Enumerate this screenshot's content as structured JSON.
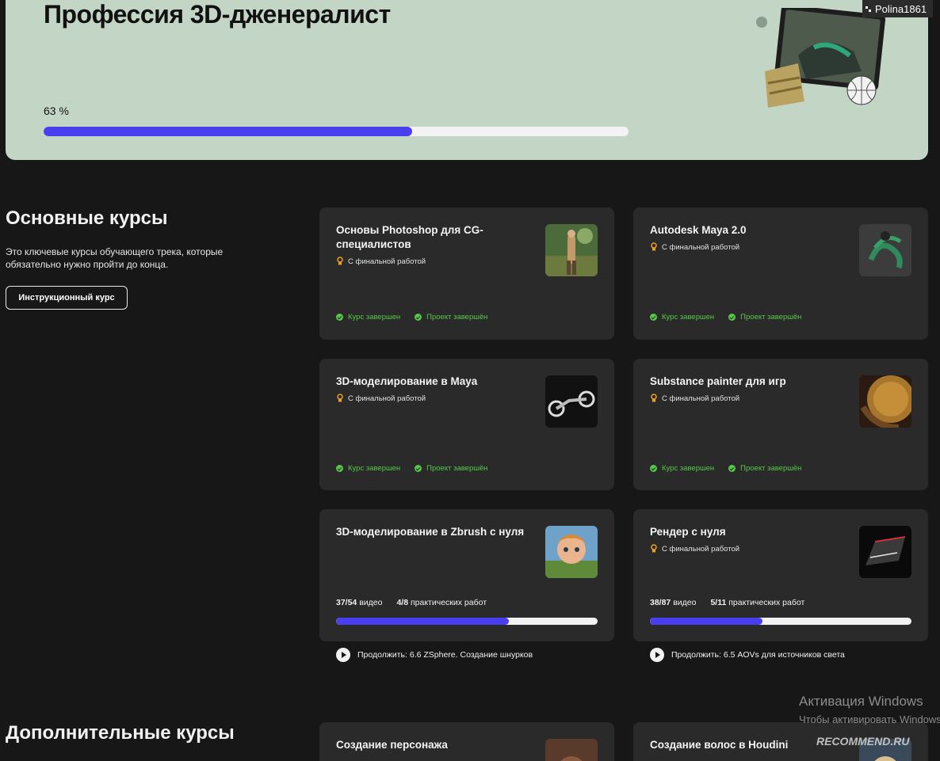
{
  "hero": {
    "title": "Профессия 3D-дженералист",
    "progress_label": "63 %",
    "progress": 0.63
  },
  "user": {
    "name": "Polina1861"
  },
  "main_section": {
    "title": "Основные курсы",
    "description": "Это ключевые курсы обучающего трека, которые обязательно нужно пройти до конца.",
    "button_label": "Инструкционный курс"
  },
  "extra_section": {
    "title": "Дополнительные курсы"
  },
  "cards": [
    {
      "title": "Основы Photoshop для CG-специалистов",
      "tag": "С финальной работой",
      "status_course": "Курс завершен",
      "status_project": "Проект завершён"
    },
    {
      "title": "Autodesk Maya 2.0",
      "tag": "С финальной работой",
      "status_course": "Курс завершен",
      "status_project": "Проект завершён"
    },
    {
      "title": "3D-моделирование в Maya",
      "tag": "С финальной работой",
      "status_course": "Курс завершен",
      "status_project": "Проект завершён"
    },
    {
      "title": "Substance painter для игр",
      "tag": "С финальной работой",
      "status_course": "Курс завершен",
      "status_project": "Проект завершён"
    },
    {
      "title": "3D-моделирование в Zbrush с нуля",
      "videos": "37/54",
      "videos_label": "видео",
      "works": "4/8",
      "works_label": "практических работ",
      "progress": 0.66,
      "continue": "Продолжить: 6.6 ZSphere. Создание шнурков"
    },
    {
      "title": "Рендер с нуля",
      "tag": "С финальной работой",
      "videos": "38/87",
      "videos_label": "видео",
      "works": "5/11",
      "works_label": "практических работ",
      "progress": 0.43,
      "continue": "Продолжить: 6.5 AOVs для источников света"
    },
    {
      "title": "Создание персонажа"
    },
    {
      "title": "Создание волос в Houdini"
    }
  ],
  "overlay": {
    "activation_title": "Активация Windows",
    "activation_text": "Чтобы активировать Windows",
    "recommend": "RECOMMEND.RU"
  },
  "colors": {
    "accent": "#4a3ff0",
    "hero_bg": "#c3d5c5",
    "card_bg": "#2a2a2a",
    "success": "#55c84a",
    "page_bg": "#171717"
  }
}
